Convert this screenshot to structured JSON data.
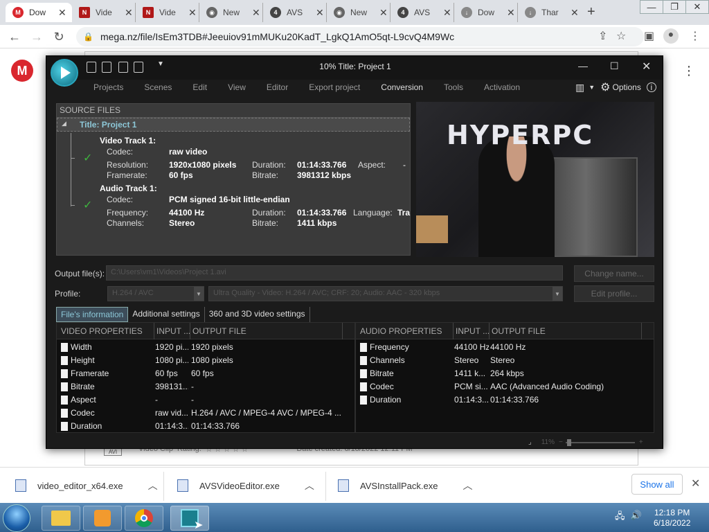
{
  "browser": {
    "tabs": [
      {
        "label": "Dow",
        "icon": "mega-icon",
        "color": "#d9272e"
      },
      {
        "label": "Vide",
        "icon": "nch-icon",
        "color": "#b01818"
      },
      {
        "label": "Vide",
        "icon": "nch-icon",
        "color": "#b01818"
      },
      {
        "label": "New",
        "icon": "chrome-icon",
        "color": "#666666"
      },
      {
        "label": "AVS",
        "icon": "avs-icon",
        "color": "#444444"
      },
      {
        "label": "New",
        "icon": "chrome-icon",
        "color": "#666666"
      },
      {
        "label": "AVS",
        "icon": "avs-icon",
        "color": "#444444"
      },
      {
        "label": "Dow",
        "icon": "download-icon",
        "color": "#888888"
      },
      {
        "label": "Thar",
        "icon": "download-icon",
        "color": "#888888"
      }
    ],
    "url": "mega.nz/file/IsEm3TDB#Jeeuiov91mMUKu20KadT_LgkQ1AmO5qt-L9cvQ4M9Wc"
  },
  "page": {
    "logo": "M",
    "file_row": {
      "icon_label": "AVI",
      "title": "Video Clip",
      "rating_label": "Rating:",
      "date": "Date created: 6/18/2022 12:11 PM"
    }
  },
  "avs": {
    "caption": "10% Title: Project 1",
    "menu": [
      "Projects",
      "Scenes",
      "Edit",
      "View",
      "Editor",
      "Export project",
      "Conversion",
      "Tools",
      "Activation"
    ],
    "active_menu": "Conversion",
    "options_label": "Options",
    "source": {
      "header": "SOURCE FILES",
      "title": "Title: Project 1",
      "video_track": {
        "header": "Video Track 1:",
        "codec_label": "Codec:",
        "codec": "raw video",
        "resolution_label": "Resolution:",
        "resolution": "1920x1080 pixels",
        "duration_label": "Duration:",
        "duration": "01:14:33.766",
        "aspect_label": "Aspect:",
        "aspect": "-",
        "framerate_label": "Framerate:",
        "framerate": "60 fps",
        "bitrate_label": "Bitrate:",
        "bitrate": "3981312 kbps"
      },
      "audio_track": {
        "header": "Audio Track 1:",
        "codec_label": "Codec:",
        "codec": "PCM signed 16-bit little-endian",
        "frequency_label": "Frequency:",
        "frequency": "44100 Hz",
        "duration_label": "Duration:",
        "duration": "01:14:33.766",
        "language_label": "Language:",
        "language": "Tra",
        "channels_label": "Channels:",
        "channels": "Stereo",
        "bitrate_label": "Bitrate:",
        "bitrate": "1411 kbps"
      }
    },
    "preview_logo": "HYPERPC",
    "output_label": "Output file(s):",
    "output_value": "C:\\Users\\vm1\\Videos\\Project 1.avi",
    "change_name": "Change name...",
    "profile_label": "Profile:",
    "profile_format": "H.264 / AVC",
    "profile_quality": "Ultra Quality - Video: H.264 / AVC; CRF: 20; Audio: AAC - 320 kbps",
    "edit_profile": "Edit profile...",
    "tabs": [
      "File's information",
      "Additional settings",
      "360 and 3D video settings"
    ],
    "video_table": {
      "headers": [
        "VIDEO PROPERTIES",
        "INPUT ...",
        "OUTPUT FILE"
      ],
      "rows": [
        [
          "Width",
          "1920 pi...",
          "1920 pixels"
        ],
        [
          "Height",
          "1080 pi...",
          "1080 pixels"
        ],
        [
          "Framerate",
          "60 fps",
          "60 fps"
        ],
        [
          "Bitrate",
          "398131...",
          "-"
        ],
        [
          "Aspect",
          "-",
          "-"
        ],
        [
          "Codec",
          "raw vid...",
          "H.264 / AVC / MPEG-4 AVC / MPEG-4 ..."
        ],
        [
          "Duration",
          "01:14:3...",
          "01:14:33.766"
        ]
      ]
    },
    "audio_table": {
      "headers": [
        "AUDIO PROPERTIES",
        "INPUT ...",
        "OUTPUT FILE"
      ],
      "rows": [
        [
          "Frequency",
          "44100 Hz",
          "44100 Hz"
        ],
        [
          "Channels",
          "Stereo",
          "Stereo"
        ],
        [
          "Bitrate",
          "1411 k...",
          "264 kbps"
        ],
        [
          "Codec",
          "PCM si...",
          "AAC (Advanced Audio Coding)"
        ],
        [
          "Duration",
          "01:14:3...",
          "01:14:33.766"
        ]
      ]
    },
    "zoom": "11%"
  },
  "downloads": {
    "items": [
      "video_editor_x64.exe",
      "AVSVideoEditor.exe",
      "AVSInstallPack.exe"
    ],
    "show_all": "Show all"
  },
  "taskbar": {
    "time": "12:18 PM",
    "date": "6/18/2022"
  }
}
